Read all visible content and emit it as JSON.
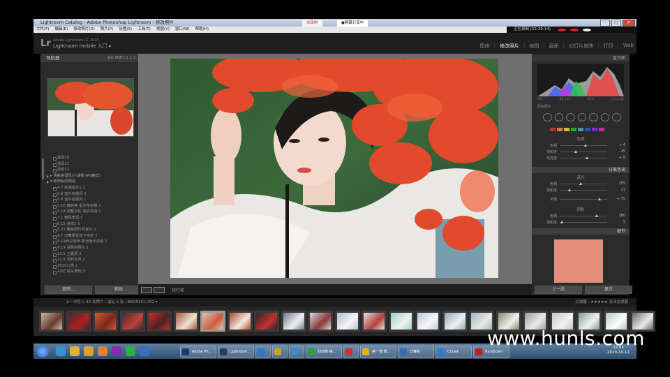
{
  "window": {
    "title": "Lightroom Catalog - Adobe Photoshop Lightroom - 修改照片",
    "rec_badge": "未录制",
    "share_badge": "●屏幕分享中",
    "rec_status": "正在录制 [02:29:14]",
    "controls": [
      "─",
      "□",
      "✕"
    ]
  },
  "menu": [
    "文件(F)",
    "编辑(E)",
    "修改照片(D)",
    "照片(P)",
    "设置(S)",
    "工具(T)",
    "视图(V)",
    "窗口(W)",
    "帮助(H)"
  ],
  "lr": {
    "logo": "Lr",
    "sub_small": "Adobe Lightroom CC 2015",
    "sub_large": "Lightroom mobile 入门  ▸",
    "modules": [
      "图库",
      "修改照片",
      "地图",
      "画册",
      "幻灯片放映",
      "打印",
      "Web"
    ],
    "active_module": "修改照片"
  },
  "left_panel": {
    "navigator_title": "导航器",
    "navigator_options": "适合  填满  1:1  1:3",
    "presets": [
      {
        "label": "选民10",
        "type": "item"
      },
      {
        "label": "选民11",
        "type": "item"
      },
      {
        "label": "选民12",
        "type": "item"
      },
      {
        "label": "▸ 清新高调风(小清新-JPG格式)",
        "type": "folder"
      },
      {
        "label": "▾ 老师私的预设",
        "type": "folder"
      },
      {
        "label": "4.7 西湖室外1 1",
        "type": "item"
      },
      {
        "label": "5.8 室外拍摄风 3",
        "type": "item"
      },
      {
        "label": "5.8 室外拍摄风 1",
        "type": "item"
      },
      {
        "label": "5.16 糖转换 星点角拍摄 1",
        "type": "item"
      },
      {
        "label": "5.18 调整对比 高调清调 1",
        "type": "item"
      },
      {
        "label": "7.1 糖珠角调 1",
        "type": "item"
      },
      {
        "label": "8.15 蓝皮2 3",
        "type": "item"
      },
      {
        "label": "8.21 植物园竹林室外 2",
        "type": "item"
      },
      {
        "label": "9.7 旧藏厦室城下帘拍 3",
        "type": "item"
      },
      {
        "label": "9.19武汉荷田 柔光暗光清晨 2",
        "type": "item"
      },
      {
        "label": "9.19 清雅拍照片 1",
        "type": "item"
      },
      {
        "label": "11.1 尘露清 3",
        "type": "item"
      },
      {
        "label": "11.5 光鲜女风 2",
        "type": "item"
      },
      {
        "label": "2019九重 2",
        "type": "item"
      },
      {
        "label": "10亿 镜头景色 3",
        "type": "item"
      }
    ],
    "copy_label": "复制...",
    "paste_label": "粘贴"
  },
  "toolbar": {
    "softproof": "软打样"
  },
  "right_panel": {
    "histogram_title": "直方图",
    "hist_info": [
      "ISO",
      "85 mm",
      "f/2.0",
      "1/100 秒"
    ],
    "original_photo": "原始照片",
    "hsl_section": "色调",
    "hsl_tone": [
      {
        "label": "色相",
        "value": "+ 4",
        "pos": 0.55
      },
      {
        "label": "饱和度",
        "value": "- 25",
        "pos": 0.35
      },
      {
        "label": "明亮度",
        "value": "+ 8",
        "pos": 0.58
      }
    ],
    "split_toning_title": "分离色调",
    "highlights_label": "高光",
    "split_highlights": [
      {
        "label": "色相",
        "value": "155",
        "pos": 0.45
      },
      {
        "label": "饱和度",
        "value": "21",
        "pos": 0.22
      }
    ],
    "balance": {
      "label": "平衡",
      "value": "+ 75",
      "pos": 0.85
    },
    "shadows_label": "阴影",
    "split_shadows": [
      {
        "label": "色相",
        "value": "280",
        "pos": 0.78
      },
      {
        "label": "饱和度",
        "value": "5",
        "pos": 0.05
      }
    ],
    "details_title": "细节",
    "prev_label": "上一张",
    "reset_label": "复位"
  },
  "filmstrip_bar": {
    "left": "上一次导入   43 张照片 / 选定 1 张 / B8G6161.CR2 ▾",
    "filter_label": "过滤器 :",
    "filter_value": "关闭过滤器"
  },
  "filmstrip": {
    "selected_index": 6,
    "thumbs": [
      {
        "c1": "#c9b8a8",
        "c2": "#6a3a2a"
      },
      {
        "c1": "#3a2a2a",
        "c2": "#b02020"
      },
      {
        "c1": "#d05a3a",
        "c2": "#7a2a1a"
      },
      {
        "c1": "#402a2a",
        "c2": "#c04040"
      },
      {
        "c1": "#c03030",
        "c2": "#502020"
      },
      {
        "c1": "#a05a3a",
        "c2": "#f0e0d0"
      },
      {
        "c1": "#d8c8b8",
        "c2": "#d05a3a"
      },
      {
        "c1": "#b04a2a",
        "c2": "#f0e8e0"
      },
      {
        "c1": "#2a2a2a",
        "c2": "#c03030"
      },
      {
        "c1": "#6a7a8a",
        "c2": "#f0f0f0"
      },
      {
        "c1": "#d8d8d8",
        "c2": "#8a3a3a"
      },
      {
        "c1": "#b0c0d0",
        "c2": "#f5f5f5"
      },
      {
        "c1": "#e8e0d8",
        "c2": "#b04040"
      },
      {
        "c1": "#a0d0d0",
        "c2": "#f0f0f0"
      },
      {
        "c1": "#b8c8d8",
        "c2": "#f8f8f8"
      },
      {
        "c1": "#90a8b8",
        "c2": "#f0f0f0"
      },
      {
        "c1": "#a0b8c0",
        "c2": "#e8e8e8"
      },
      {
        "c1": "#7a8a6a",
        "c2": "#f0f0f0"
      },
      {
        "c1": "#8aa0a8",
        "c2": "#f0e8e8"
      },
      {
        "c1": "#c0c8d0",
        "c2": "#f5f0f0"
      },
      {
        "c1": "#80a090",
        "c2": "#f0f0f0"
      },
      {
        "c1": "#b0c8b8",
        "c2": "#ffffff"
      },
      {
        "c1": "#607070",
        "c2": "#e8e8e8"
      }
    ]
  },
  "taskbar": {
    "items": [
      {
        "label": "Adobe Ph...",
        "color": "#1e3a6e"
      },
      {
        "label": "Lightroom...",
        "color": "#2a3a5a"
      },
      {
        "label": "",
        "color": "#2a7ad0"
      },
      {
        "label": "",
        "color": "#d0a020"
      },
      {
        "label": "",
        "color": "#3a8ad0"
      },
      {
        "label": "刘亦菲 精...",
        "color": "#2aa040"
      },
      {
        "label": "",
        "color": "#d03030"
      },
      {
        "label": "第一课 修...",
        "color": "#e0b020"
      },
      {
        "label": "计算机",
        "color": "#3a6ab0"
      },
      {
        "label": "CCtalk",
        "color": "#2a80d0"
      },
      {
        "label": "Bandicam",
        "color": "#c02020"
      }
    ],
    "pins": [
      "#3a90d0",
      "#e0b030",
      "#e0a030",
      "#e08030",
      "#8a2ab0",
      "#30b040",
      "#3a70c0"
    ],
    "time": "22:05",
    "date": "2019-10-11"
  },
  "watermark": "www.hunls.com"
}
